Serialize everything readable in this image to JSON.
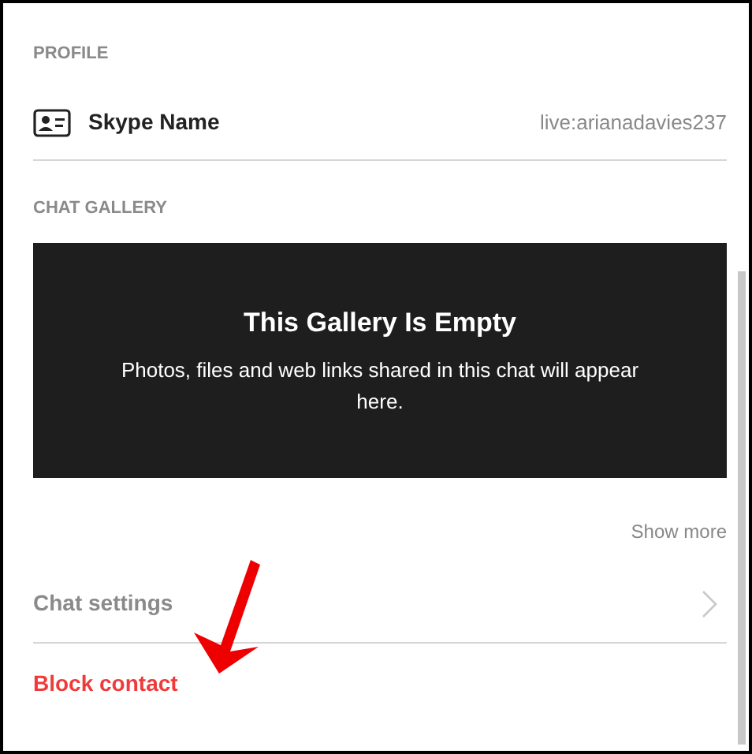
{
  "profile": {
    "heading": "PROFILE",
    "field_label": "Skype Name",
    "field_value": "live:arianadavies237"
  },
  "chat_gallery": {
    "heading": "CHAT GALLERY",
    "empty_title": "This Gallery Is Empty",
    "empty_message": "Photos, files and web links shared in this chat will appear here.",
    "show_more": "Show more"
  },
  "actions": [
    {
      "kind": "link",
      "label": "Chat settings"
    },
    {
      "kind": "danger",
      "label": "Block contact"
    }
  ]
}
